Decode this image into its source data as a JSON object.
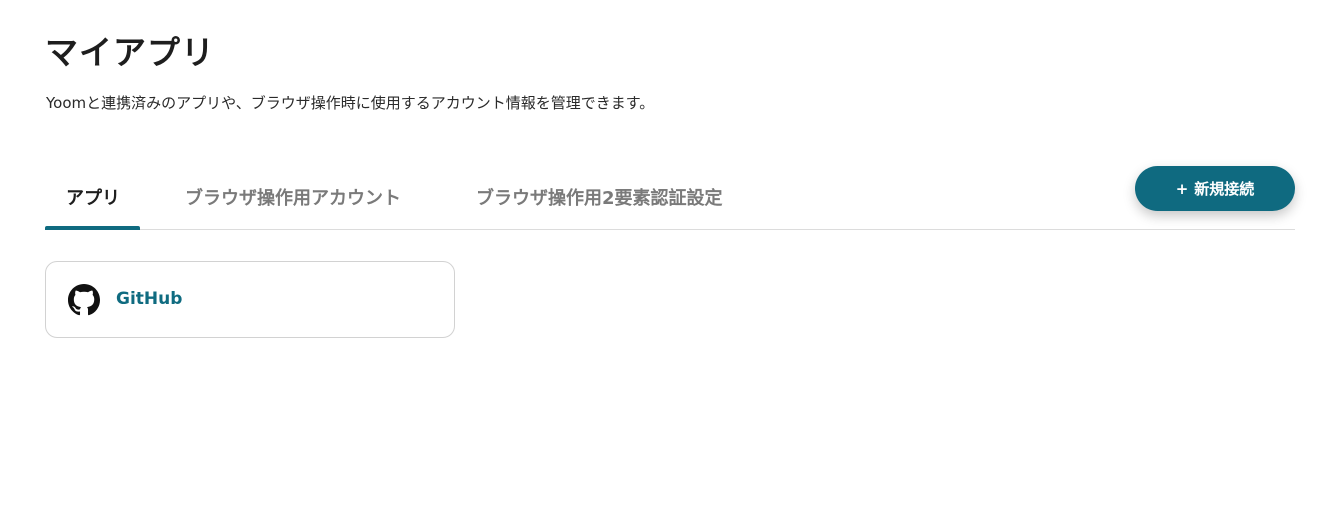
{
  "header": {
    "title": "マイアプリ",
    "description": "Yoomと連携済みのアプリや、ブラウザ操作時に使用するアカウント情報を管理できます。"
  },
  "tabs": [
    {
      "label": "アプリ",
      "active": true
    },
    {
      "label": "ブラウザ操作用アカウント",
      "active": false
    },
    {
      "label": "ブラウザ操作用2要素認証設定",
      "active": false
    }
  ],
  "actions": {
    "new_connection_icon": "+",
    "new_connection_label": "新規接続"
  },
  "apps": [
    {
      "name": "GitHub",
      "icon": "github-icon"
    }
  ],
  "colors": {
    "accent": "#0f6b80",
    "title": "#1e1e1e",
    "inactive_tab": "#7a7a7a",
    "border": "#d2d2d2"
  }
}
